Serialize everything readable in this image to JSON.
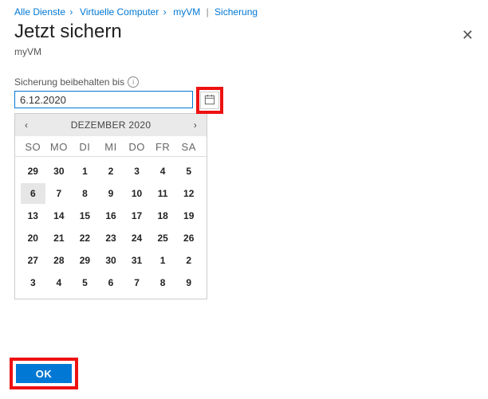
{
  "breadcrumb": {
    "items": [
      "Alle Dienste",
      "Virtuelle Computer",
      "myVM"
    ],
    "last": "Sicherung"
  },
  "header": {
    "title": "Jetzt sichern",
    "subtitle": "myVM",
    "close_label": "✕"
  },
  "field": {
    "label": "Sicherung beibehalten bis",
    "info_glyph": "i",
    "value": "6.12.2020"
  },
  "calendar": {
    "prev": "‹",
    "next": "›",
    "title": "DEZEMBER 2020",
    "daynames": [
      "SO",
      "MO",
      "DI",
      "MI",
      "DO",
      "FR",
      "SA"
    ],
    "weeks": [
      [
        {
          "d": "29",
          "o": true
        },
        {
          "d": "30",
          "o": true
        },
        {
          "d": "1"
        },
        {
          "d": "2"
        },
        {
          "d": "3"
        },
        {
          "d": "4"
        },
        {
          "d": "5"
        }
      ],
      [
        {
          "d": "6",
          "sel": true
        },
        {
          "d": "7"
        },
        {
          "d": "8"
        },
        {
          "d": "9"
        },
        {
          "d": "10"
        },
        {
          "d": "11"
        },
        {
          "d": "12"
        }
      ],
      [
        {
          "d": "13"
        },
        {
          "d": "14"
        },
        {
          "d": "15"
        },
        {
          "d": "16"
        },
        {
          "d": "17"
        },
        {
          "d": "18"
        },
        {
          "d": "19"
        }
      ],
      [
        {
          "d": "20"
        },
        {
          "d": "21"
        },
        {
          "d": "22"
        },
        {
          "d": "23"
        },
        {
          "d": "24"
        },
        {
          "d": "25"
        },
        {
          "d": "26"
        }
      ],
      [
        {
          "d": "27"
        },
        {
          "d": "28"
        },
        {
          "d": "29"
        },
        {
          "d": "30"
        },
        {
          "d": "31"
        },
        {
          "d": "1",
          "o": true
        },
        {
          "d": "2",
          "o": true
        }
      ],
      [
        {
          "d": "3",
          "o": true
        },
        {
          "d": "4",
          "o": true
        },
        {
          "d": "5",
          "o": true
        },
        {
          "d": "6",
          "o": true
        },
        {
          "d": "7",
          "o": true
        },
        {
          "d": "8",
          "o": true
        },
        {
          "d": "9",
          "o": true
        }
      ]
    ]
  },
  "actions": {
    "ok": "OK"
  },
  "colors": {
    "accent": "#0078d4",
    "highlight_border": "#e11"
  }
}
